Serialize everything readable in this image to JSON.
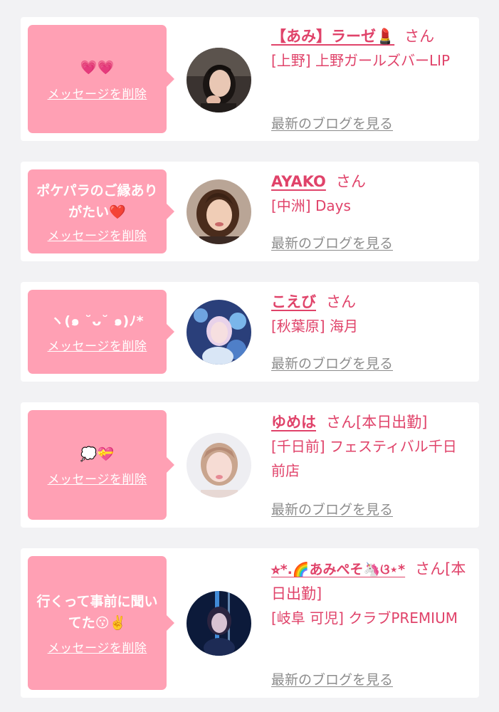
{
  "delete_label": "メッセージを削除",
  "san_label": "さん",
  "blog_label": "最新のブログを見る",
  "colors": {
    "bubble": "#ffa0b4",
    "accent": "#e0436a",
    "blog_link": "#8c8c8c",
    "background": "#f2f2f4"
  },
  "items": [
    {
      "message": "💗💗",
      "name": "【あみ】ラーゼ💄",
      "badge": "",
      "shop": "[上野] 上野ガールズバーLIP"
    },
    {
      "message": "ポケパラのご縁ありがたい❤️",
      "name": "AYAKO",
      "badge": "",
      "shop": "[中洲] Days"
    },
    {
      "message": "ヽ(๑ ˘ᴗ˘ ๑)ﾉ*",
      "name": "こえび",
      "badge": "",
      "shop": "[秋葉原] 海月"
    },
    {
      "message": "💭💝",
      "name": "ゆめは",
      "badge": "[本日出勤]",
      "shop": "[千日前] フェスティバル千日前店"
    },
    {
      "message": "行くって事前に聞いてた😗✌️",
      "name": "⭐︎*.🌈あみぺそ🦄ଓ⋆*",
      "badge": "[本日出勤]",
      "shop": "[岐阜 可児] クラブPREMIUM"
    }
  ]
}
